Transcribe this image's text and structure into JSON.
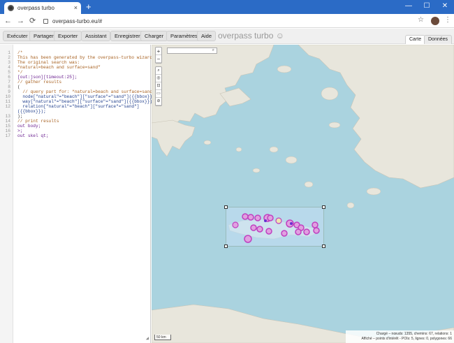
{
  "browser": {
    "tab_title": "overpass turbo",
    "tab_close": "×",
    "new_tab": "+",
    "window_buttons": [
      "—",
      "☐",
      "✕"
    ],
    "url": "overpass-turbo.eu/#",
    "nav_back": "←",
    "nav_forward": "→",
    "nav_reload": "⟳",
    "star": "☆",
    "menu": "⋮"
  },
  "toolbar": {
    "buttons": [
      "Exécuter",
      "Partager",
      "Exporter",
      "Assistant",
      "Enregistrer",
      "Charger",
      "Paramètres",
      "Aide"
    ],
    "brand": "overpass turbo ☺",
    "view_tabs": [
      "Carte",
      "Données"
    ]
  },
  "editor": {
    "line_numbers": [
      "1",
      "2",
      "3",
      "4",
      "5",
      "6",
      "7",
      "8",
      "9",
      "10",
      "11",
      "12",
      "13",
      "14",
      "15",
      "16",
      "17"
    ],
    "lines": [
      "/*",
      "This has been generated by the overpass-turbo wizard.",
      "The original search was:",
      "“natural=beach and surface=sand”",
      "*/",
      "[out:json][timeout:25];",
      "// gather results",
      "(",
      "  // query part for: “natural=beach and surface=sand”",
      "  node[\"natural\"=\"beach\"][\"surface\"=\"sand\"]({{bbox}});",
      "  way[\"natural\"=\"beach\"][\"surface\"=\"sand\"]({{bbox}});",
      "  relation[\"natural\"=\"beach\"][\"surface\"=\"sand\"]",
      "({{bbox}});",
      ");",
      "// print results",
      "out body;",
      ">;",
      "out skel qt;"
    ]
  },
  "map": {
    "zoom_in": "+",
    "zoom_out": "−",
    "tools": [
      "⌕",
      "◎",
      "⊡",
      "▭",
      "⊘"
    ],
    "search_icon": "⌕",
    "scale": "50 km",
    "attribution": "© OSM",
    "stats_loaded": "Chargé – nœuds: 1355, chemins: 67, relations: 1",
    "stats_shown": "Affiché – points d'intérêt - POIs: 5, lignes: 0, polygones: 66",
    "colors": {
      "sea": "#aad3df",
      "land": "#e8e6dc",
      "marker": "#c040c0",
      "marker_fill": "#9a3be0"
    }
  }
}
